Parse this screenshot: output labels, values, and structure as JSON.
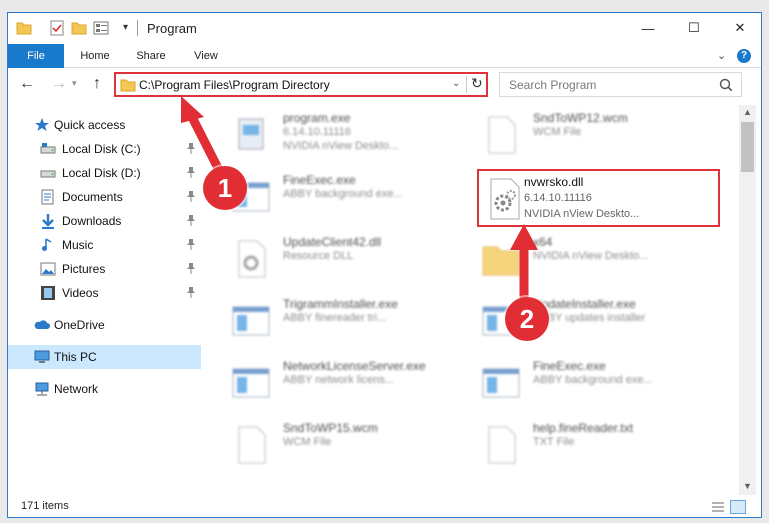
{
  "window": {
    "title": "Program",
    "controls": {
      "minimize": "—",
      "maximize": "☐",
      "close": "✕"
    }
  },
  "ribbon": {
    "tabs": [
      "File",
      "Home",
      "Share",
      "View"
    ],
    "expand_icon": "chevron-down-icon",
    "help": "?"
  },
  "navigation": {
    "address": "C:\\Program Files\\Program Directory",
    "search_placeholder": "Search Program"
  },
  "sidebar": {
    "items": [
      {
        "label": "Quick access",
        "icon": "star-icon",
        "pinned": false
      },
      {
        "label": "Local Disk (C:)",
        "icon": "drive-icon",
        "pinned": true
      },
      {
        "label": "Local Disk (D:)",
        "icon": "drive-icon",
        "pinned": true
      },
      {
        "label": "Documents",
        "icon": "documents-icon",
        "pinned": true
      },
      {
        "label": "Downloads",
        "icon": "downloads-icon",
        "pinned": true
      },
      {
        "label": "Music",
        "icon": "music-icon",
        "pinned": true
      },
      {
        "label": "Pictures",
        "icon": "pictures-icon",
        "pinned": true
      },
      {
        "label": "Videos",
        "icon": "videos-icon",
        "pinned": true
      },
      {
        "label": "OneDrive",
        "icon": "cloud-icon",
        "pinned": false
      },
      {
        "label": "This PC",
        "icon": "pc-icon",
        "pinned": false,
        "selected": true
      },
      {
        "label": "Network",
        "icon": "network-icon",
        "pinned": false
      }
    ]
  },
  "files": [
    {
      "name": "program.exe",
      "version": "6.14.10.11116",
      "description": "NVIDIA nView Deskto...",
      "icon": "exe-icon"
    },
    {
      "name": "SndToWP12.wcm",
      "version": "",
      "description": "WCM File",
      "icon": "blank-file-icon"
    },
    {
      "name": "FineExec.exe",
      "version": "",
      "description": "ABBY background exe...",
      "icon": "app-window-icon"
    },
    {
      "name": "nvwrsko.dll",
      "version": "6.14.10.11116",
      "description": "NVIDIA nView Deskto...",
      "icon": "dll-gear-icon",
      "highlighted": true
    },
    {
      "name": "UpdateClient42.dll",
      "version": "",
      "description": "Resource DLL",
      "icon": "dll-gear-icon"
    },
    {
      "name": "x64",
      "version": "",
      "description": "NVIDIA nView Deskto...",
      "icon": "folder-icon"
    },
    {
      "name": "TrigrammInstaller.exe",
      "version": "",
      "description": "ABBY finereader tri...",
      "icon": "app-window-icon"
    },
    {
      "name": "UpdateInstaller.exe",
      "version": "",
      "description": "ABBY updates installer",
      "icon": "app-window-icon"
    },
    {
      "name": "NetworkLicenseServer.exe",
      "version": "",
      "description": "ABBY network licens...",
      "icon": "app-window-icon"
    },
    {
      "name": "FineExec.exe",
      "version": "",
      "description": "ABBY background exe...",
      "icon": "app-window-icon"
    },
    {
      "name": "SndToWP15.wcm",
      "version": "",
      "description": "WCM File",
      "icon": "blank-file-icon"
    },
    {
      "name": "help.fineReader.txt",
      "version": "",
      "description": "TXT File",
      "icon": "blank-file-icon"
    }
  ],
  "status": {
    "item_count": "171 items"
  },
  "annotations": [
    {
      "label": "1"
    },
    {
      "label": "2"
    }
  ],
  "colors": {
    "accent": "#1979ca",
    "highlight": "#e0323a",
    "selection": "#cce8ff"
  }
}
